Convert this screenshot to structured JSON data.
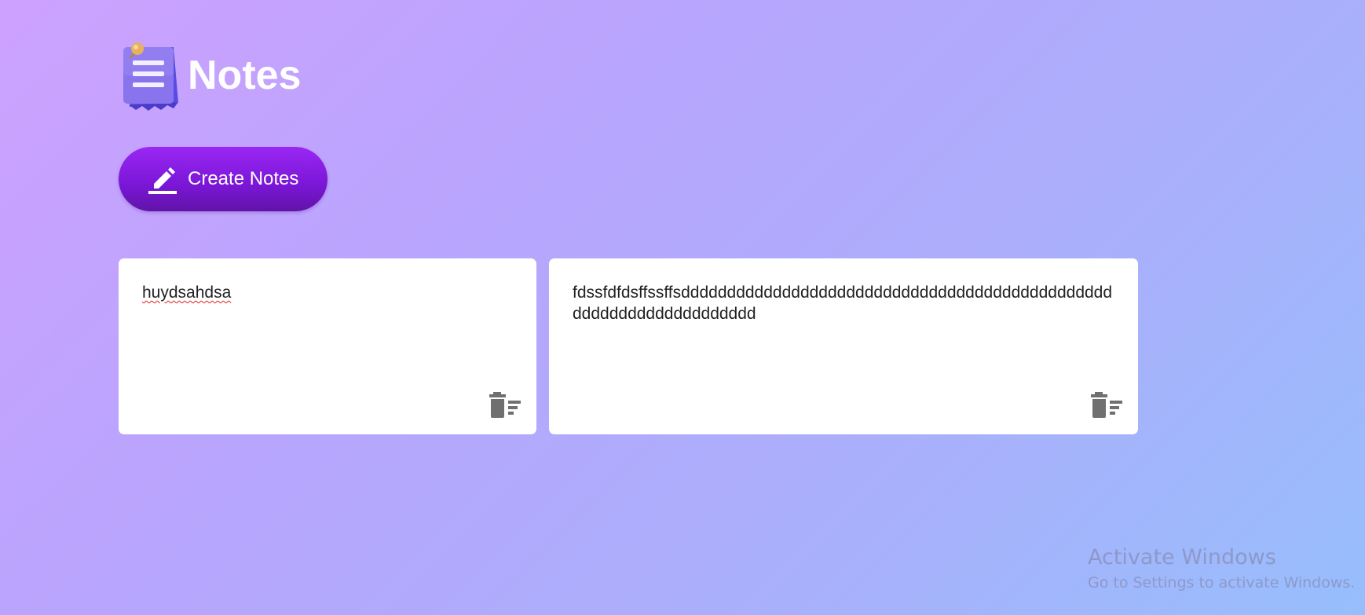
{
  "app": {
    "title": "Notes",
    "logo_icon": "notes-pad-icon"
  },
  "toolbar": {
    "create_label": "Create Notes",
    "create_icon": "pencil-icon"
  },
  "notes": [
    {
      "text": "huydsahdsa",
      "delete_icon": "delete-sweep-icon"
    },
    {
      "text": "fdssfdfdsffssffsddddddddddddddddddddddddddddddddddddddddddddddddddddddddddddddddddd",
      "delete_icon": "delete-sweep-icon"
    }
  ],
  "watermark": {
    "title": "Activate Windows",
    "subtitle": "Go to Settings to activate Windows."
  },
  "colors": {
    "accent": "#8a1fe8",
    "background_start": "#cda1ff",
    "background_end": "#97befc",
    "card": "#ffffff",
    "icon_gray": "#707070"
  }
}
